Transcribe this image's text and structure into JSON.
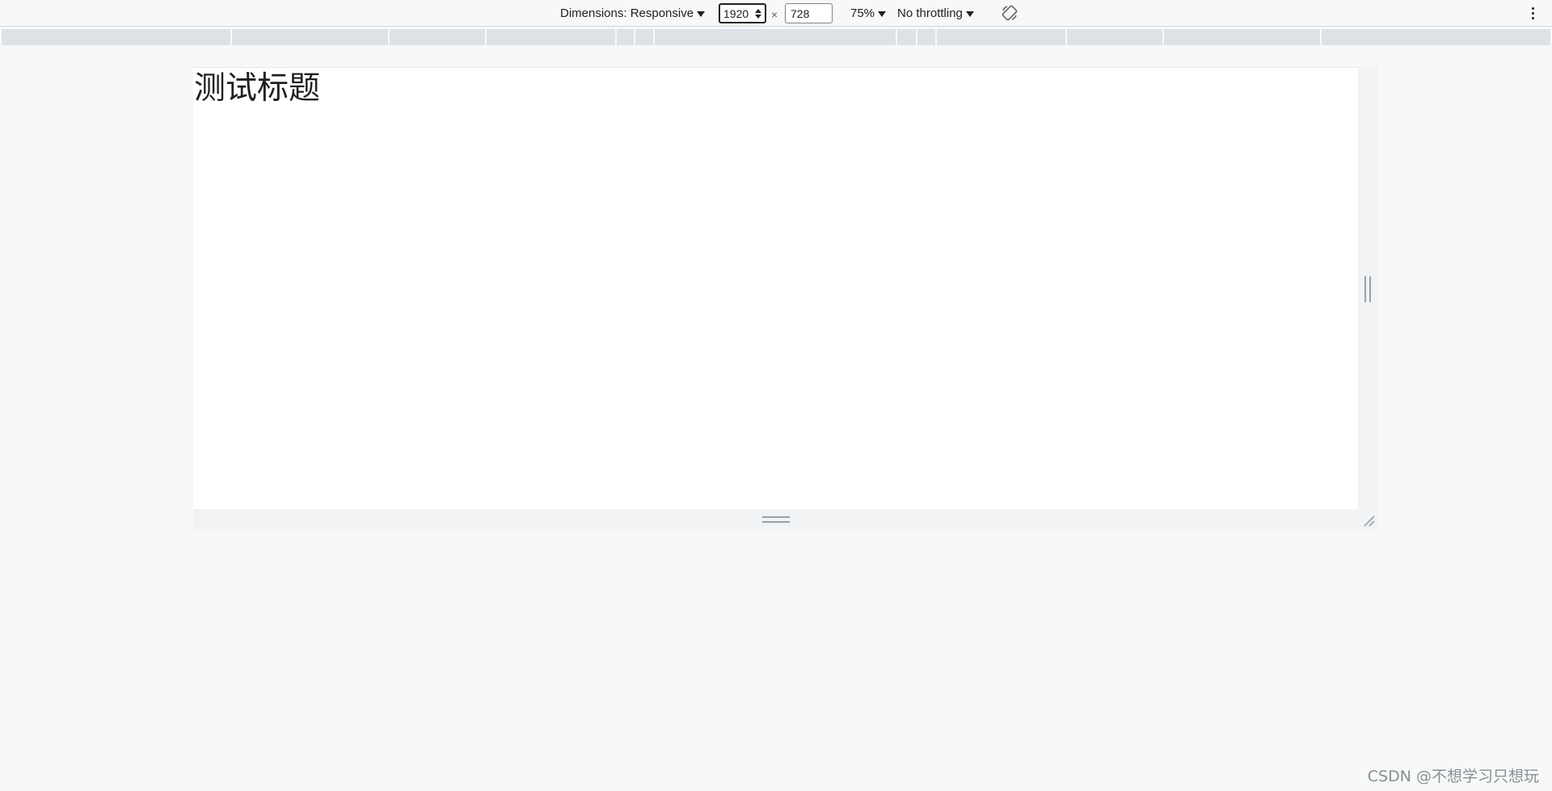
{
  "toolbar": {
    "dimensions_label": "Dimensions: Responsive",
    "width_value": "1920",
    "times_symbol": "×",
    "height_value": "728",
    "zoom_label": "75%",
    "throttling_label": "No throttling",
    "rotate_icon": "rotate-icon",
    "more_icon": "more-vert-icon"
  },
  "page": {
    "heading": "测试标题"
  },
  "watermark": "CSDN @不想学习只想玩"
}
